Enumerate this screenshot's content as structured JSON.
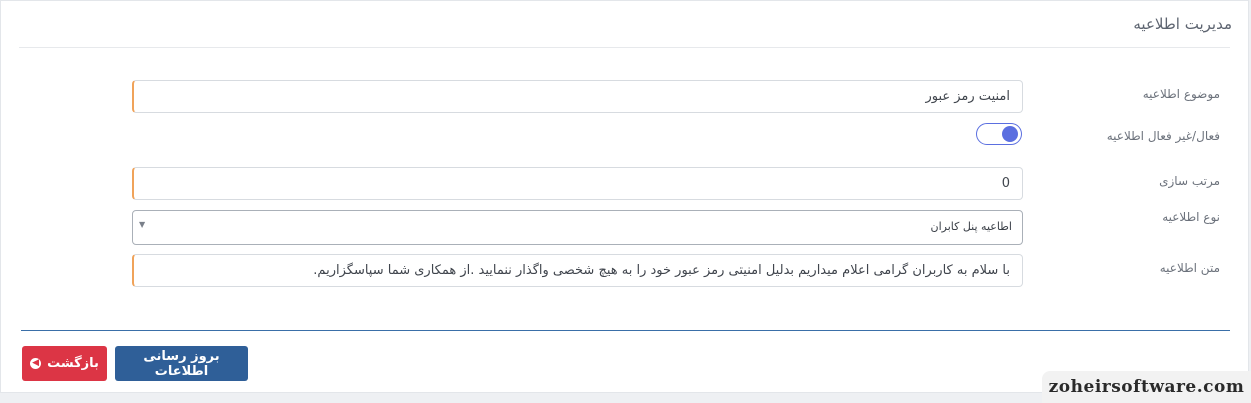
{
  "card": {
    "title": "مدیریت اطلاعیه"
  },
  "form": {
    "subject": {
      "label": "موضوع اطلاعیه",
      "value": "امنیت رمز عبور"
    },
    "active": {
      "label": "فعال/غیر فعال اطلاعیه",
      "checked": true
    },
    "sort": {
      "label": "مرتب سازی",
      "value": "0"
    },
    "type": {
      "label": "نوع اطلاعیه",
      "selected": "اطاعیه پنل کابران"
    },
    "body": {
      "label": "متن اطلاعیه",
      "value": "با سلام به کاربران گرامی اعلام میداریم بدلیل امنیتی رمز عبور خود را به هیچ شخصی واگذار ننمایید .از همکاری شما سپاسگزاریم."
    }
  },
  "buttons": {
    "update_label": "بروز رسانی اطلاعات",
    "back_label": "بازگشت"
  },
  "watermark": {
    "text": "zoheirsoftware.com"
  },
  "colors": {
    "accent": "#5b6fe0",
    "primary_button": "#2f5f98",
    "danger_button": "#dc3545",
    "required_border": "#f0a35a"
  }
}
